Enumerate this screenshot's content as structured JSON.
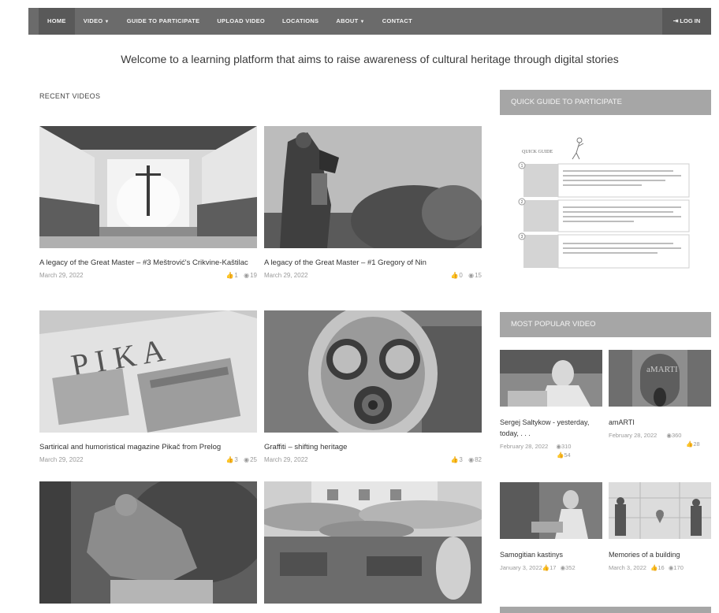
{
  "nav": {
    "items": [
      {
        "label": "HOME",
        "active": true
      },
      {
        "label": "VIDEO",
        "dropdown": true
      },
      {
        "label": "GUIDE TO PARTICIPATE"
      },
      {
        "label": "UPLOAD VIDEO"
      },
      {
        "label": "LOCATIONS"
      },
      {
        "label": "ABOUT",
        "dropdown": true
      },
      {
        "label": "CONTACT"
      }
    ],
    "login_label": "LOG IN",
    "login_icon": "sign-in-icon"
  },
  "welcome": "Welcome to a learning platform that aims to raise awareness of cultural heritage through digital stories",
  "recent": {
    "title": "RECENT VIDEOS",
    "videos": [
      {
        "title": "A legacy of the Great Master – #3 Meštrović's Crikvine-Kaštilac",
        "date": "March 29, 2022",
        "likes": "1",
        "views": "19"
      },
      {
        "title": "A legacy of the Great Master – #1 Gregory of Nin",
        "date": "March 29, 2022",
        "likes": "0",
        "views": "15"
      },
      {
        "title": "Sartirical and humoristical magazine Pikač from Prelog",
        "date": "March 29, 2022",
        "likes": "3",
        "views": "25"
      },
      {
        "title": "Graffiti – shifting heritage",
        "date": "March 29, 2022",
        "likes": "3",
        "views": "82"
      }
    ]
  },
  "sidebar": {
    "guide_title": "QUICK GUIDE TO PARTICIPATE",
    "guide_image_text": "QUICK GUIDE",
    "guide_steps": [
      "1",
      "2",
      "3"
    ],
    "popular_title": "MOST POPULAR VIDEO",
    "popular": [
      {
        "title": "Sergej Saltykow - yesterday, today, . . .",
        "date": "February 28, 2022",
        "views": "310",
        "likes": "54"
      },
      {
        "title": "amARTI",
        "date": "February 28, 2022",
        "views": "360",
        "likes": "28"
      },
      {
        "title": "Samogitian kastinys",
        "date": "January 3, 2022",
        "likes": "17",
        "views": "352"
      },
      {
        "title": "Memories of a building",
        "date": "March 3, 2022",
        "likes": "16",
        "views": "170"
      }
    ]
  },
  "icons": {
    "like": "thumbs-up-icon",
    "view": "eye-icon"
  },
  "colors": {
    "nav_bg": "#6b6b6b",
    "sidebar_header_bg": "#a6a6a6"
  }
}
